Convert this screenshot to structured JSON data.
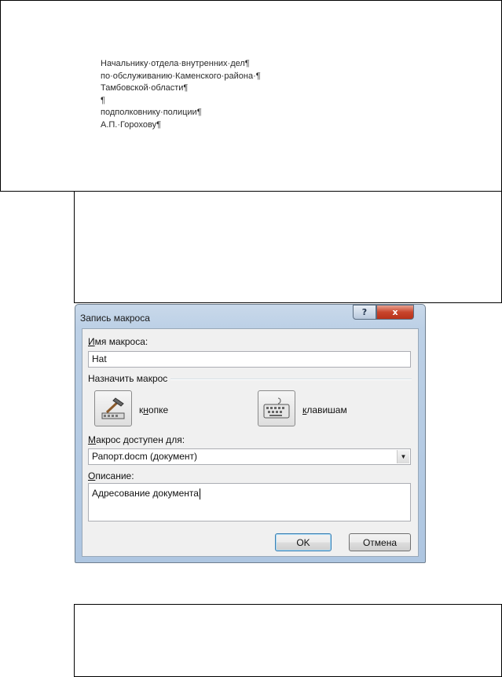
{
  "document": {
    "lines": [
      "Начальнику·отдела·внутренних·дел¶",
      "по·обслуживанию·Каменского·района·¶",
      "Тамбовской·области¶",
      "¶",
      "подполковнику·полиции¶",
      "А.П.·Горохову¶"
    ]
  },
  "dialog": {
    "title": "Запись макроса",
    "help_glyph": "?",
    "close_glyph": "x",
    "macro_name_label_u": "И",
    "macro_name_label_rest": "мя макроса:",
    "macro_name_value": "Hat",
    "assign_label": "Назначить макрос",
    "button_option_pre": "к",
    "button_option_u": "н",
    "button_option_rest": "опке",
    "keys_option_u": "к",
    "keys_option_rest": "лавишам",
    "store_label_u": "М",
    "store_label_rest": "акрос доступен для:",
    "store_value": "Рапорт.docm (документ)",
    "description_label_u": "О",
    "description_label_rest": "писание:",
    "description_value": "Адресование документа",
    "ok_label": "OK",
    "cancel_label": "Отмена",
    "dropdown_glyph": "▼"
  }
}
